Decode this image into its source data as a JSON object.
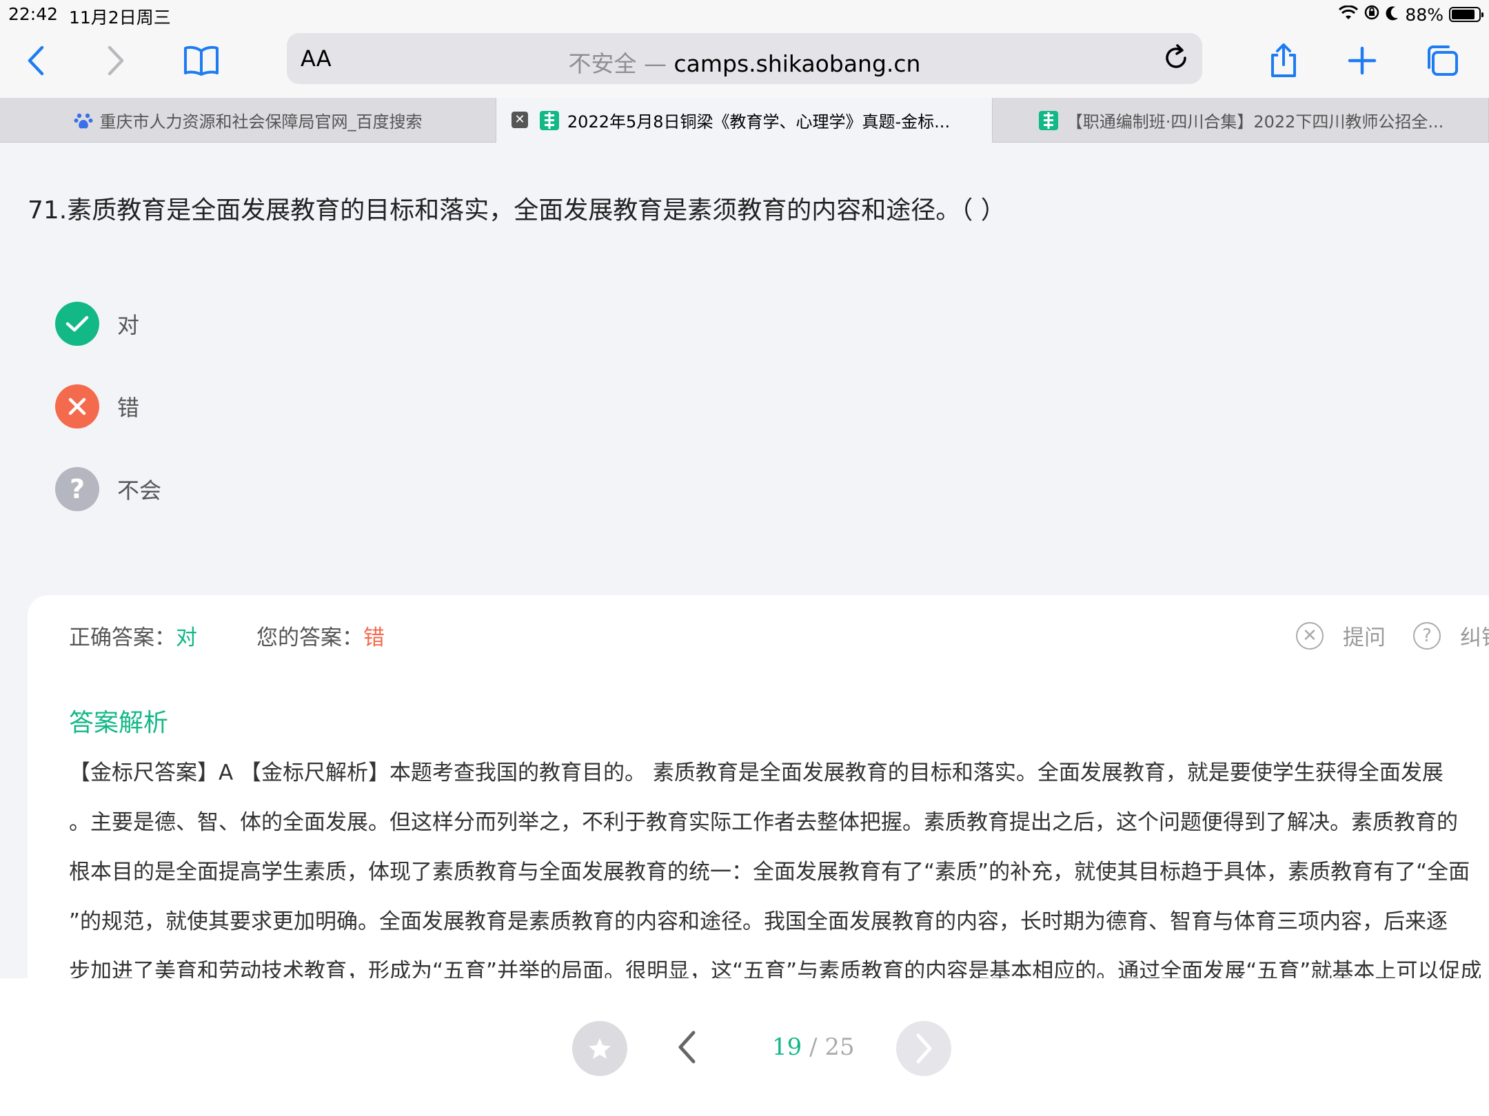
{
  "status": {
    "time": "22:42",
    "date": "11月2日周三",
    "battery": "88%"
  },
  "address_bar": {
    "aa_label": "AA",
    "insecure": "不安全",
    "separator": " — ",
    "domain": "camps.shikaobang.cn"
  },
  "tabs": [
    {
      "title": "重庆市人力资源和社会保障局官网_百度搜索",
      "active": false,
      "icon": "baidu-paw-icon"
    },
    {
      "title": "2022年5月8日铜梁《教育学、心理学》真题-金标...",
      "active": true,
      "icon": "shikaobang-icon"
    },
    {
      "title": "【职通编制班·四川合集】2022下四川教师公招全...",
      "active": false,
      "icon": "shikaobang-icon"
    }
  ],
  "question": {
    "text": "71.素质教育是全面发展教育的目标和落实，全面发展教育是素须教育的内容和途径。（ ）"
  },
  "options": [
    {
      "label": "对",
      "state": "correct"
    },
    {
      "label": "错",
      "state": "selected-wrong"
    },
    {
      "label": "不会",
      "state": "unknown"
    }
  ],
  "answer": {
    "correct_label": "正确答案：",
    "correct_value": "对",
    "yours_label": "您的答案：",
    "yours_value": "错",
    "ask": "提问",
    "report": "纠错"
  },
  "analysis": {
    "title": "答案解析",
    "lines": [
      "【金标尺答案】A 【金标尺解析】本题考查我国的教育目的。 素质教育是全面发展教育的目标和落实。全面发展教育，就是要使学生获得全面发展",
      "。主要是德、智、体的全面发展。但这样分而列举之，不利于教育实际工作者去整体把握。素质教育提出之后，这个问题便得到了解决。素质教育的",
      "根本目的是全面提高学生素质，体现了素质教育与全面发展教育的统一：全面发展教育有了“素质”的补充，就使其目标趋于具体，素质教育有了“全面",
      "”的规范，就使其要求更加明确。全面发展教育是素质教育的内容和途径。我国全面发展教育的内容，长时期为德育、智育与体育三项内容，后来逐",
      "步加进了美育和劳动技术教育，形成为“五育”并举的局面。很明显，这“五育”与素质教育的内容是基本相应的。通过全面发展“五育”就基本上可以促成"
    ]
  },
  "pagination": {
    "current": "19",
    "separator": " / ",
    "total": "25"
  },
  "colors": {
    "accent_green": "#12b886",
    "error_red": "#f46a4d",
    "link_blue": "#1e7cf2"
  }
}
